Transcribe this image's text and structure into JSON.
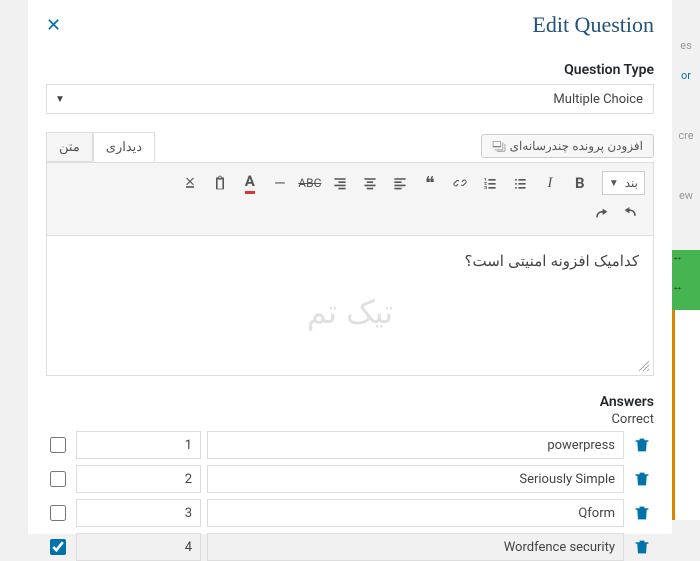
{
  "modal": {
    "title": "Edit Question"
  },
  "question_type": {
    "label": "Question Type",
    "value": "Multiple Choice"
  },
  "editor": {
    "tab_visual": "دیداری",
    "tab_text": "متن",
    "media_button": "افزودن پرونده چندرسانه‌ای",
    "format_label": "بند",
    "content": "کدامیک افزونه امنیتی است؟",
    "watermark": "تیک تم"
  },
  "answers": {
    "label": "Answers",
    "correct_label": "Correct",
    "rows": [
      {
        "n": "1",
        "text": "powerpress",
        "correct": false
      },
      {
        "n": "2",
        "text": "Seriously Simple",
        "correct": false
      },
      {
        "n": "3",
        "text": "Qform",
        "correct": false
      },
      {
        "n": "4",
        "text": "Wordfence security",
        "correct": true
      }
    ]
  },
  "side_fragments": {
    "a": "es",
    "b": "or",
    "c": "cre",
    "d": "ew"
  }
}
